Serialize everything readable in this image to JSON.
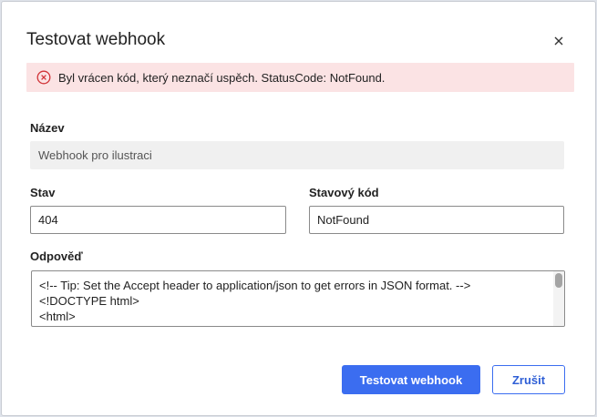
{
  "dialog": {
    "title": "Testovat webhook",
    "close_icon": "close-icon"
  },
  "alert": {
    "icon": "error-circle-icon",
    "message": "Byl vrácen kód, který neznačí uspěch. StatusCode: NotFound."
  },
  "form": {
    "name_label": "Název",
    "name_value": "Webhook pro ilustraci",
    "status_label": "Stav",
    "status_value": "404",
    "status_code_label": "Stavový kód",
    "status_code_value": "NotFound",
    "response_label": "Odpověď",
    "response_value": "<!-- Tip: Set the Accept header to application/json to get errors in JSON format. -->\n<!DOCTYPE html>\n<html>"
  },
  "buttons": {
    "test_label": "Testovat webhook",
    "cancel_label": "Zrušit"
  },
  "colors": {
    "accent": "#3b6df0",
    "alert_bg": "#fbe3e4",
    "alert_icon": "#d13438"
  }
}
